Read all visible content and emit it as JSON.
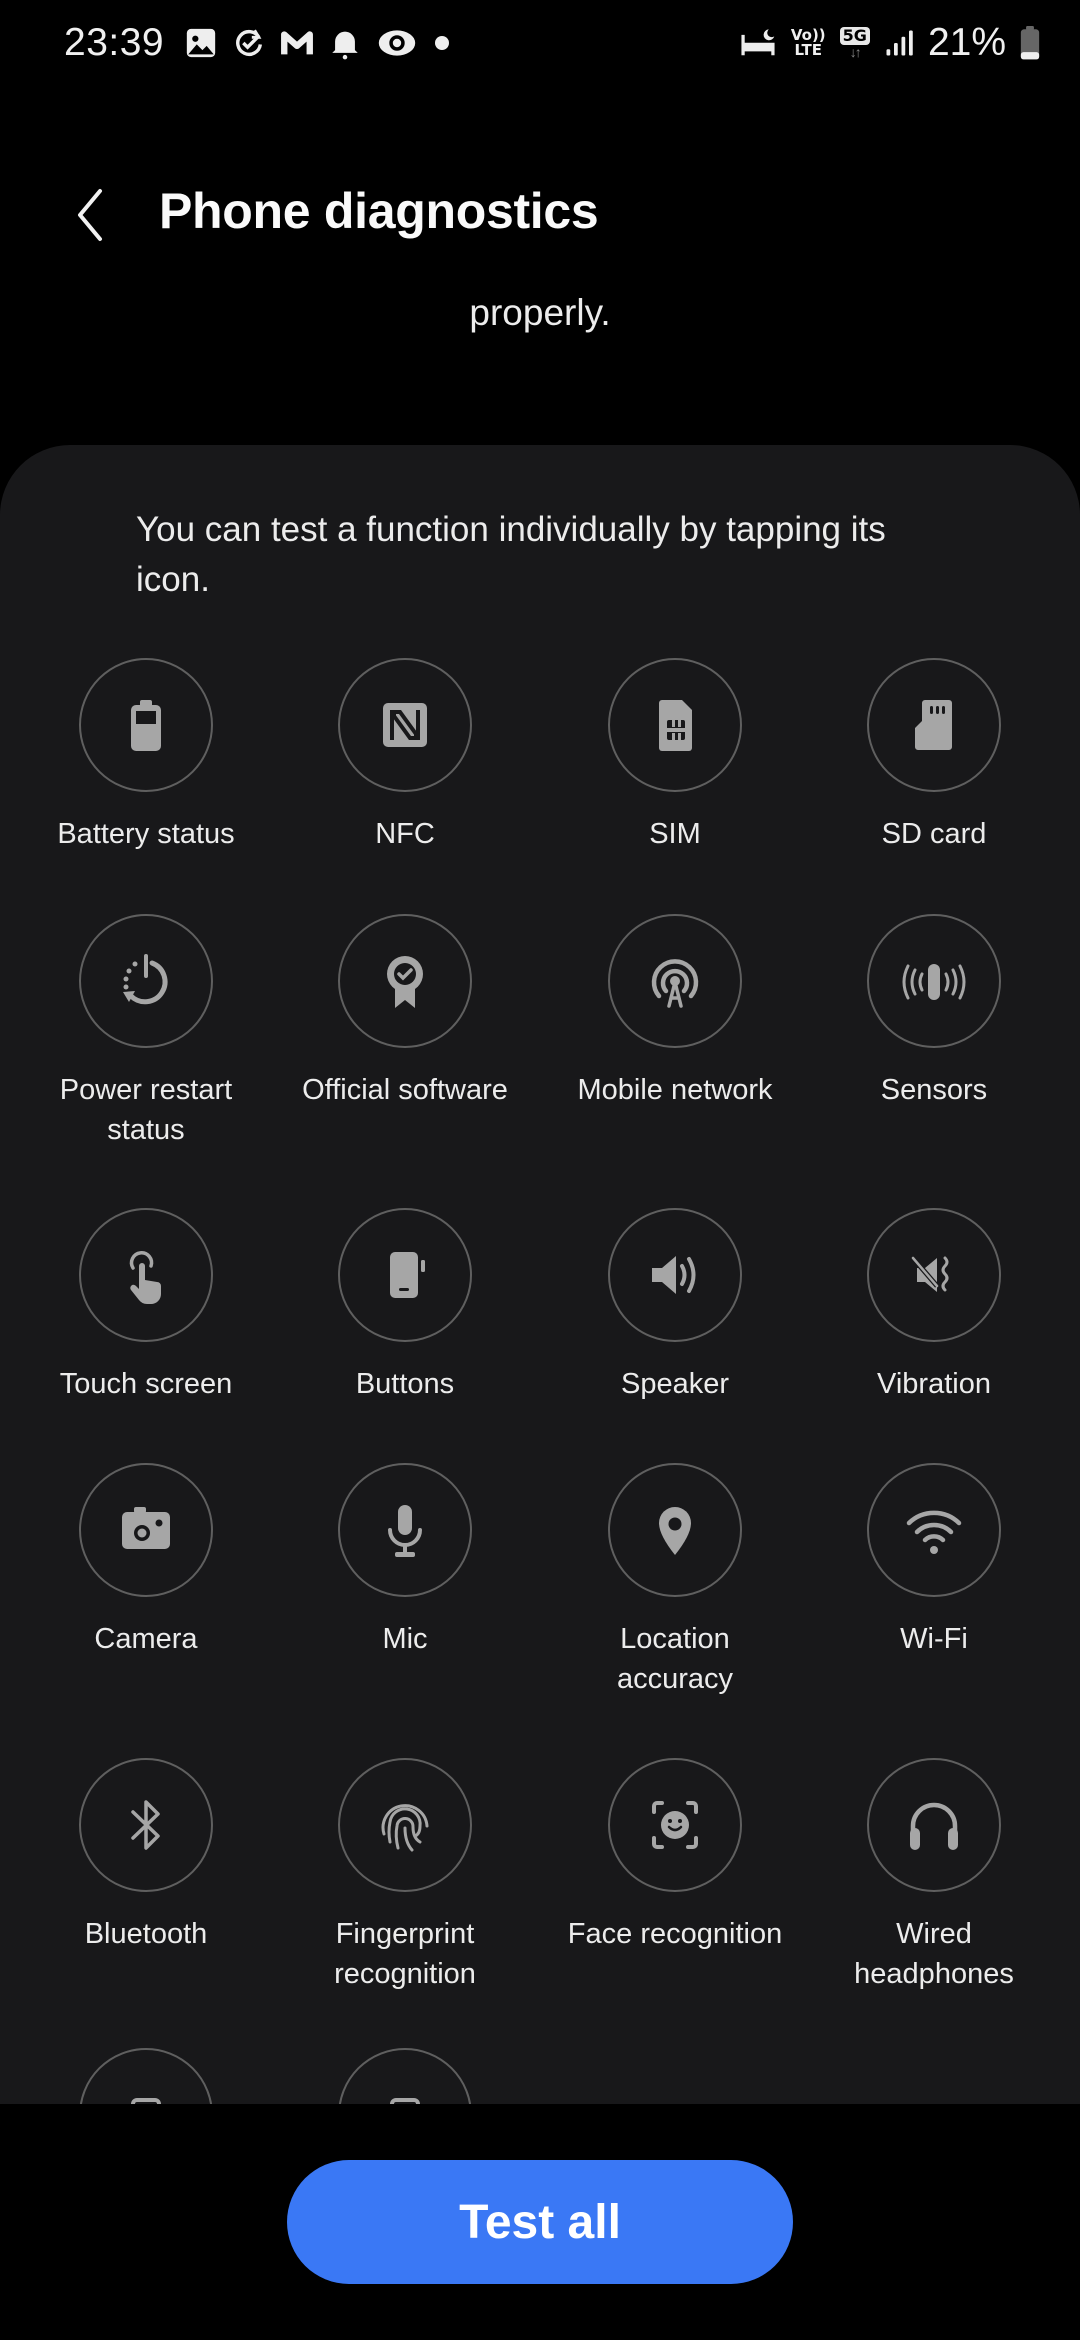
{
  "status_bar": {
    "time": "23:39",
    "left_icons": [
      "gallery-icon",
      "task-check-icon",
      "gmail-icon",
      "notification-bell-icon",
      "app-eye-icon",
      "more-notifications-dot-icon"
    ],
    "right_icons": [
      "sleep-mode-icon",
      "volte-icon",
      "5g-icon",
      "signal-icon",
      "battery-icon"
    ],
    "volte_top": "Vo))",
    "volte_bottom": "LTE",
    "network_type": "5G",
    "data_arrows": "↓↑",
    "battery_percent": "21%"
  },
  "header": {
    "back_label": "Back",
    "title": "Phone diagnostics"
  },
  "partial_description_tail": "properly.",
  "card": {
    "intro": "You can test a function individually by tapping its icon.",
    "items": [
      {
        "label": "Battery status",
        "icon": "battery-icon"
      },
      {
        "label": "NFC",
        "icon": "nfc-icon"
      },
      {
        "label": "SIM",
        "icon": "sim-card-icon"
      },
      {
        "label": "SD card",
        "icon": "sd-card-icon"
      },
      {
        "label": "Power restart\nstatus",
        "icon": "power-restart-icon"
      },
      {
        "label": "Official software",
        "icon": "certified-badge-icon"
      },
      {
        "label": "Mobile network",
        "icon": "antenna-icon"
      },
      {
        "label": "Sensors",
        "icon": "sensors-icon"
      },
      {
        "label": "Touch screen",
        "icon": "touch-hand-icon"
      },
      {
        "label": "Buttons",
        "icon": "phone-buttons-icon"
      },
      {
        "label": "Speaker",
        "icon": "speaker-icon"
      },
      {
        "label": "Vibration",
        "icon": "vibration-icon"
      },
      {
        "label": "Camera",
        "icon": "camera-icon"
      },
      {
        "label": "Mic",
        "icon": "mic-icon"
      },
      {
        "label": "Location\naccuracy",
        "icon": "location-pin-icon"
      },
      {
        "label": "Wi-Fi",
        "icon": "wifi-icon"
      },
      {
        "label": "Bluetooth",
        "icon": "bluetooth-icon"
      },
      {
        "label": "Fingerprint\nrecognition",
        "icon": "fingerprint-icon"
      },
      {
        "label": "Face recognition",
        "icon": "face-recognition-icon"
      },
      {
        "label": "Wired\nheadphones",
        "icon": "headphones-icon"
      },
      {
        "label": "",
        "icon": "partially-hidden-icon"
      },
      {
        "label": "",
        "icon": "partially-hidden-icon"
      }
    ]
  },
  "actions": {
    "test_all_label": "Test all"
  },
  "colors": {
    "accent": "#3a78f5",
    "card_bg": "#18181a",
    "icon_fill": "#a6a6a6",
    "circle_stroke": "#5f5f5f"
  }
}
